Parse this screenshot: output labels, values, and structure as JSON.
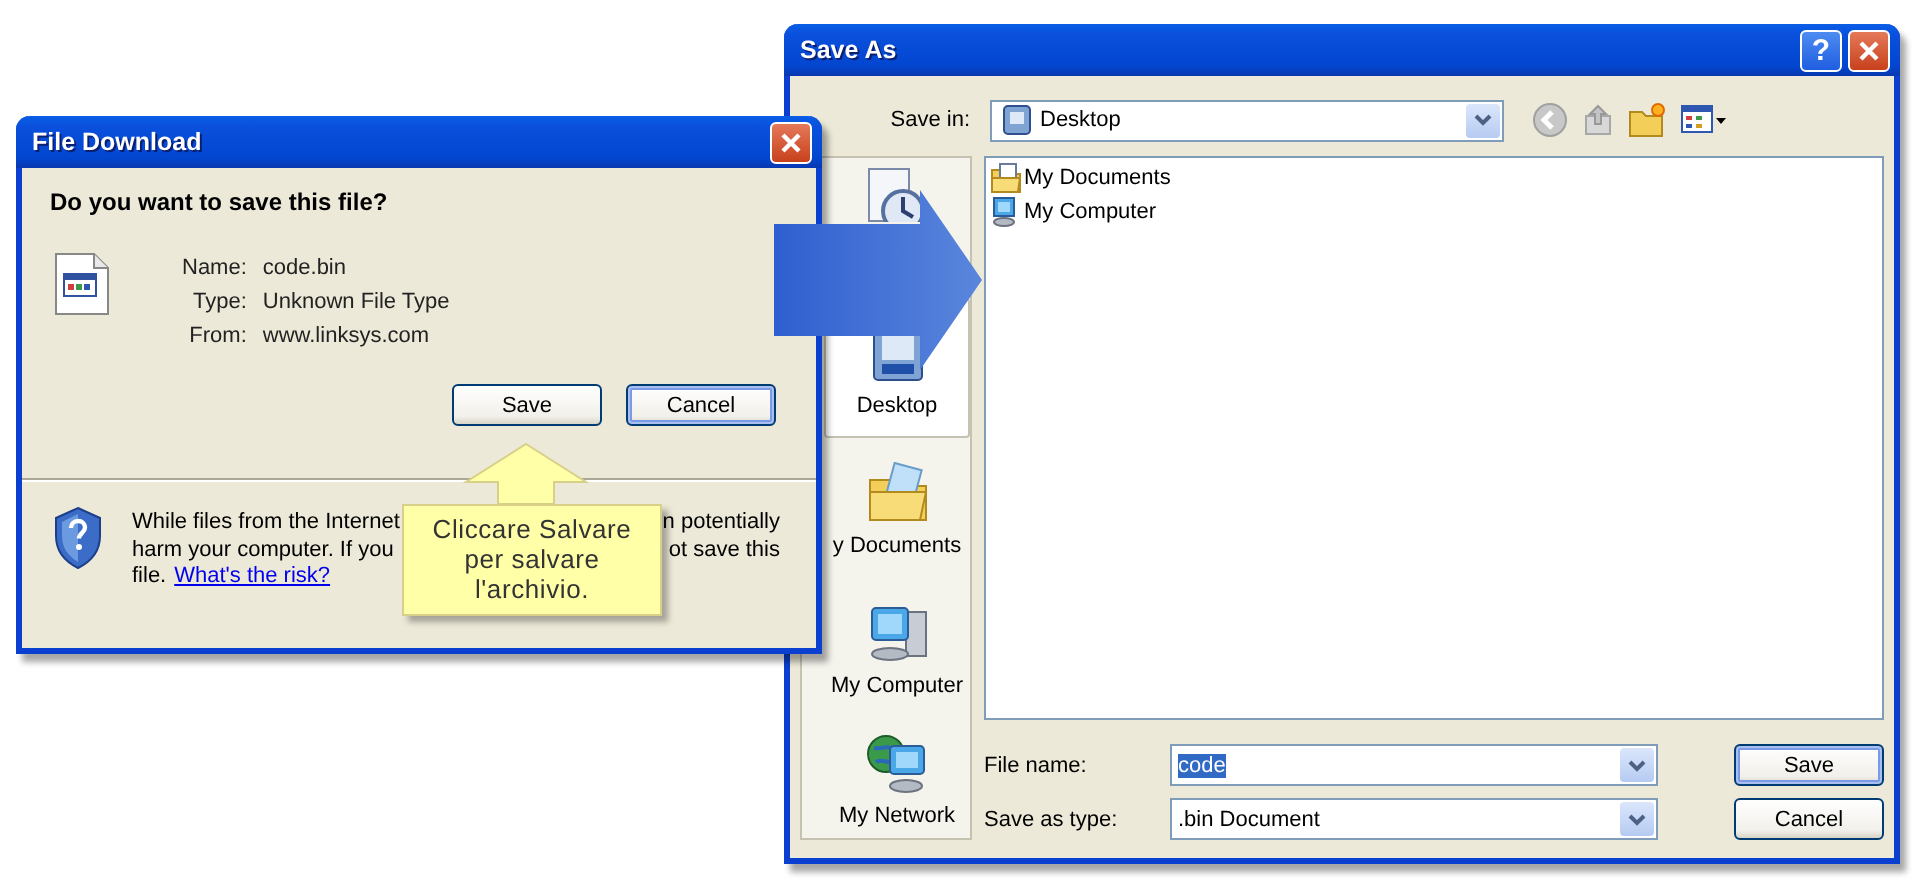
{
  "save_as": {
    "title": "Save As",
    "help_button": "?",
    "save_in": {
      "label": "Save in:",
      "value": "Desktop"
    },
    "places": [
      {
        "kind": "recent",
        "selected": false
      },
      {
        "kind": "desktop",
        "label": "Desktop",
        "selected": true
      },
      {
        "kind": "documents",
        "label": "y Documents",
        "selected": false
      },
      {
        "kind": "computer",
        "label": "My Computer",
        "selected": false
      },
      {
        "kind": "network",
        "label": "My Network",
        "selected": false
      }
    ],
    "files": [
      {
        "kind": "documents",
        "name": "My Documents"
      },
      {
        "kind": "computer",
        "name": "My Computer"
      }
    ],
    "file_name": {
      "label": "File name:",
      "value": "code",
      "selected": true
    },
    "save_as_type": {
      "label": "Save as type:",
      "value": ".bin Document"
    },
    "buttons": [
      {
        "label": "Save",
        "default": true
      },
      {
        "label": "Cancel",
        "default": false
      }
    ]
  },
  "file_download": {
    "title": "File Download",
    "question": "Do you want to save this file?",
    "details": [
      {
        "label": "Name:",
        "value": "code.bin"
      },
      {
        "label": "Type:",
        "value": "Unknown File Type"
      },
      {
        "label": "From:",
        "value": "www.linksys.com"
      }
    ],
    "buttons": [
      {
        "label": "Save",
        "focused": false
      },
      {
        "label": "Cancel",
        "focused": true
      }
    ],
    "info": {
      "lines": [
        [
          "While files from the Internet",
          "n potentially"
        ],
        [
          "harm your computer. If you",
          "ot save this"
        ]
      ],
      "last_line": "file.",
      "link": "What's the risk?"
    }
  },
  "callout": {
    "lines": [
      "Cliccare Salvare",
      "per salvare",
      "l'archivio."
    ]
  }
}
